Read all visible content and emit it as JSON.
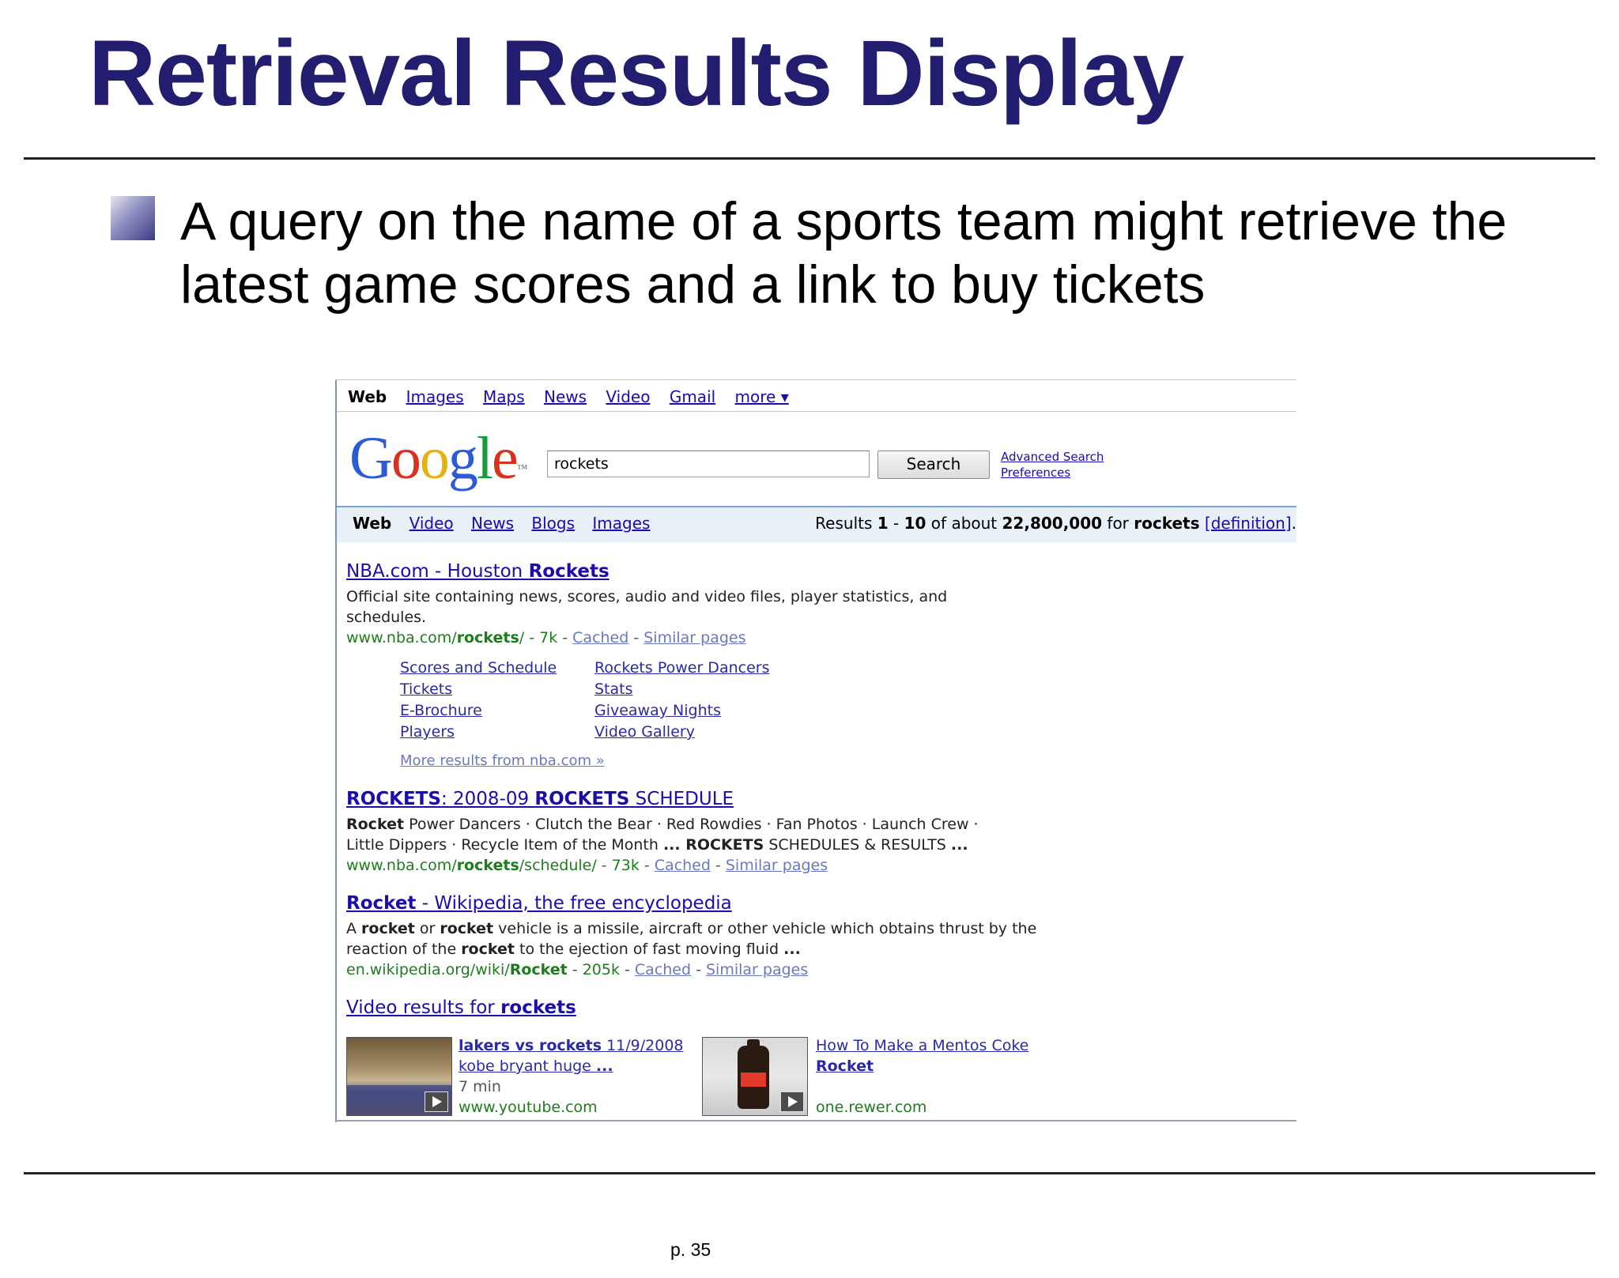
{
  "slide": {
    "title": "Retrieval Results Display",
    "bullet": "A query on the name of a sports team might retrieve the latest game scores and a link to buy tickets",
    "page_number": "p. 35"
  },
  "google": {
    "top_nav": [
      "Web",
      "Images",
      "Maps",
      "News",
      "Video",
      "Gmail",
      "more ▾"
    ],
    "logo": "Google",
    "search_query": "rockets",
    "search_button": "Search",
    "advanced_search": "Advanced Search",
    "preferences": "Preferences",
    "result_tabs": [
      "Web",
      "Video",
      "News",
      "Blogs",
      "Images"
    ],
    "stats": {
      "prefix": "Results ",
      "range_start": "1",
      "range_sep": " - ",
      "range_end": "10",
      "mid": " of about ",
      "total": "22,800,000",
      "for_text": " for ",
      "query": "rockets",
      "definition": "[definition]",
      "suffix": "."
    },
    "result1": {
      "title_plain": "NBA.com - Houston ",
      "title_kw": "Rockets",
      "snippet_line1": "Official site containing news, scores, audio and video files, player statistics, and",
      "snippet_line2": "schedules.",
      "url_plain": "www.nba.com/",
      "url_bold": "rockets",
      "url_rest": "/ - 7k - ",
      "cached": "Cached",
      "sep": " - ",
      "similar": "Similar pages",
      "sitelinks_left": [
        "Scores and Schedule",
        "Tickets",
        "E-Brochure",
        "Players"
      ],
      "sitelinks_right": [
        "Rockets Power Dancers",
        "Stats",
        "Giveaway Nights",
        "Video Gallery"
      ],
      "more_results": "More results from nba.com »"
    },
    "result2": {
      "title_kw1": "ROCKETS",
      "title_mid": ": 2008-09 ",
      "title_kw2": "ROCKETS",
      "title_end": " SCHEDULE",
      "snippet_bold1": "Rocket",
      "snippet_line1_rest": " Power Dancers · Clutch the Bear · Red Rowdies · Fan Photos · Launch Crew ·",
      "snippet_line2_start": "Little Dippers · Recycle Item of the Month ",
      "snippet_bold2": "... ROCKETS",
      "snippet_line2_rest": " SCHEDULES & RESULTS ",
      "snippet_bold3": "...",
      "url_plain": "www.nba.com/",
      "url_bold": "rockets",
      "url_rest": "/schedule/ - 73k - ",
      "cached": "Cached",
      "sep": " - ",
      "similar": "Similar pages"
    },
    "result3": {
      "title_kw": "Rocket",
      "title_rest": " - Wikipedia, the free encyclopedia",
      "s1_a": "A ",
      "s1_b1": "rocket",
      "s1_c": " or ",
      "s1_b2": "rocket",
      "s1_d": " vehicle is a missile, aircraft or other vehicle which obtains thrust by the",
      "s2_a": "reaction of the ",
      "s2_b": "rocket",
      "s2_c": " to the ejection of fast moving fluid ",
      "s2_d": "...",
      "url_plain": "en.wikipedia.org/wiki/",
      "url_bold": "Rocket",
      "url_rest": " - 205k - ",
      "cached": "Cached",
      "sep": " - ",
      "similar": "Similar pages"
    },
    "videos": {
      "heading_plain": "Video results for ",
      "heading_kw": "rockets",
      "v1": {
        "title_b": "lakers vs rockets",
        "title_rest": " 11/9/2008",
        "title_line2": "kobe bryant huge ",
        "title_line2_b": "...",
        "duration": "7 min",
        "source": "www.youtube.com"
      },
      "v2": {
        "title_line1": "How To Make a Mentos Coke",
        "title_line2_b": "Rocket",
        "source": "one.rewer.com"
      }
    }
  },
  "colors": {
    "title": "#221d6e",
    "link": "#1a0dab",
    "url_green": "#1e7b1e"
  }
}
